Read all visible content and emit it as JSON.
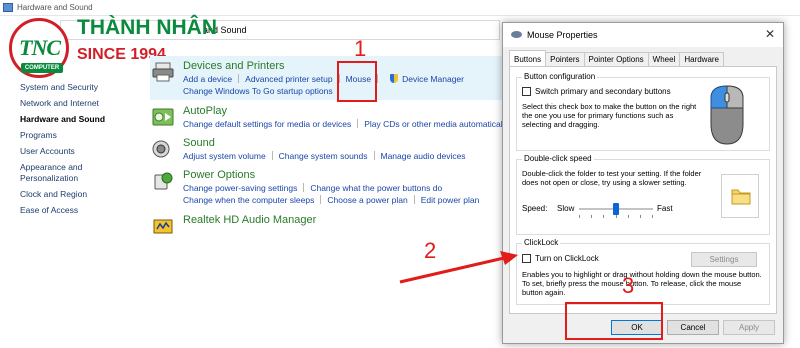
{
  "window": {
    "title": "Hardware and Sound"
  },
  "address_bar": {
    "path_fragment": "and Sound"
  },
  "logo": {
    "circle_text": "TNC",
    "circle_sub": "COMPUTER",
    "name": "THÀNH NHÂN",
    "since": "SINCE 1994"
  },
  "nav": {
    "items": [
      "System and Security",
      "Network and Internet",
      "Hardware and Sound",
      "Programs",
      "User Accounts",
      "Appearance and Personalization",
      "Clock and Region",
      "Ease of Access"
    ]
  },
  "sections": {
    "devices": {
      "title": "Devices and Printers",
      "links": [
        "Add a device",
        "Advanced printer setup",
        "Mouse",
        "Device Manager",
        "Change Windows To Go startup options"
      ]
    },
    "autoplay": {
      "title": "AutoPlay",
      "links": [
        "Change default settings for media or devices",
        "Play CDs or other media automatically"
      ]
    },
    "sound": {
      "title": "Sound",
      "links": [
        "Adjust system volume",
        "Change system sounds",
        "Manage audio devices"
      ]
    },
    "power": {
      "title": "Power Options",
      "links": [
        "Change power-saving settings",
        "Change what the power buttons do",
        "Change when the computer sleeps",
        "Choose a power plan",
        "Edit power plan"
      ]
    },
    "realtek": {
      "title": "Realtek HD Audio Manager"
    }
  },
  "dialog": {
    "title": "Mouse Properties",
    "close_glyph": "✕",
    "tabs": [
      "Buttons",
      "Pointers",
      "Pointer Options",
      "Wheel",
      "Hardware"
    ],
    "active_tab": "Buttons",
    "button_config": {
      "title": "Button configuration",
      "checkbox_label": "Switch primary and secondary buttons",
      "checked": false,
      "description": "Select this check box to make the button on the right the one you use for primary functions such as selecting and dragging."
    },
    "double_click": {
      "title": "Double-click speed",
      "description": "Double-click the folder to test your setting. If the folder does not open or close, try using a slower setting.",
      "speed_label": "Speed:",
      "slow_label": "Slow",
      "fast_label": "Fast",
      "slider_value": 0.5
    },
    "clicklock": {
      "title": "ClickLock",
      "checkbox_label": "Turn on ClickLock",
      "checked": false,
      "settings_button": "Settings",
      "description": "Enables you to highlight or drag without holding down the mouse button. To set, briefly press the mouse button. To release, click the mouse button again."
    },
    "buttons": {
      "ok": "OK",
      "cancel": "Cancel",
      "apply": "Apply"
    }
  },
  "annotations": {
    "step1": "1",
    "step2": "2",
    "step3": "3",
    "color": "#e21b1b"
  }
}
